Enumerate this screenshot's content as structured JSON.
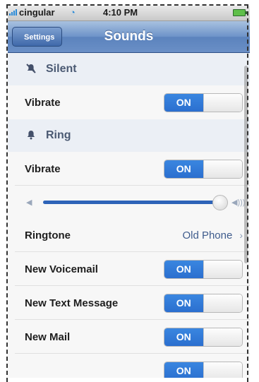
{
  "status_bar": {
    "carrier": "cingular",
    "wifi_icon": "wifi-icon",
    "time": "4:10 PM",
    "battery_icon": "battery-icon"
  },
  "nav": {
    "back_label": "Settings",
    "title": "Sounds"
  },
  "silent": {
    "header": "Silent",
    "icon": "muted-bell-icon",
    "vibrate_label": "Vibrate",
    "vibrate_state": "ON"
  },
  "ring": {
    "header": "Ring",
    "icon": "bell-icon",
    "vibrate_label": "Vibrate",
    "vibrate_state": "ON",
    "volume_level": 0.97,
    "ringtone_label": "Ringtone",
    "ringtone_value": "Old Phone"
  },
  "alerts": [
    {
      "label": "New Voicemail",
      "state": "ON"
    },
    {
      "label": "New Text Message",
      "state": "ON"
    },
    {
      "label": "New Mail",
      "state": "ON"
    },
    {
      "label": "",
      "state": "ON"
    }
  ],
  "colors": {
    "nav_blue": "#6d93c8",
    "toggle_on_blue": "#2b6fcf",
    "value_blue": "#3f5c8d",
    "section_bg": "#ebeff5"
  }
}
